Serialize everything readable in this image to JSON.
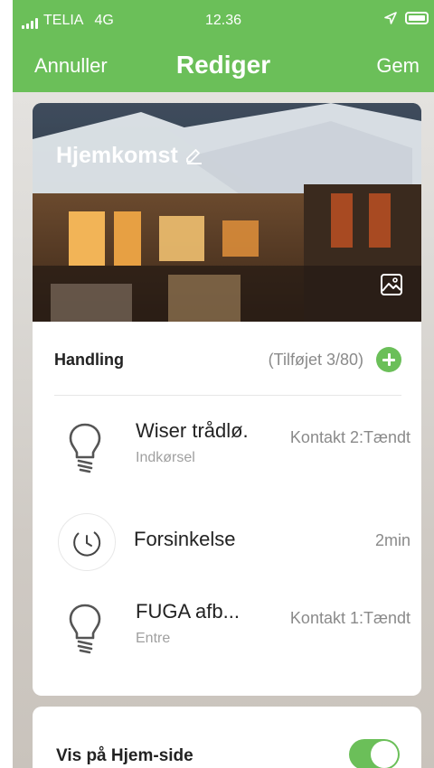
{
  "status_bar": {
    "carrier": "TELIA",
    "network": "4G",
    "time": "12.36"
  },
  "nav": {
    "cancel_label": "Annuller",
    "title": "Rediger",
    "save_label": "Gem"
  },
  "scene": {
    "name": "Hjemkomst",
    "edit_icon": "pencil-icon",
    "change_image_icon": "image-icon"
  },
  "actions": {
    "label": "Handling",
    "count_text": "(Tilføjet 3/80)",
    "add_icon": "plus-circle-icon",
    "items": [
      {
        "icon": "lightbulb-icon",
        "name": "Wiser trådlø.",
        "sub": "Indkørsel",
        "value": "Kontakt 2:Tændt"
      },
      {
        "icon": "clock-icon",
        "name": "Forsinkelse",
        "sub": "",
        "value": "2min"
      },
      {
        "icon": "lightbulb-icon",
        "name": "FUGA afb...",
        "sub": "Entre",
        "value": "Kontakt 1:Tændt"
      }
    ]
  },
  "home_page": {
    "label": "Vis på Hjem-side",
    "enabled": true
  },
  "colors": {
    "accent": "#6bbf59",
    "text": "#222222",
    "muted": "#8a8a8a"
  }
}
